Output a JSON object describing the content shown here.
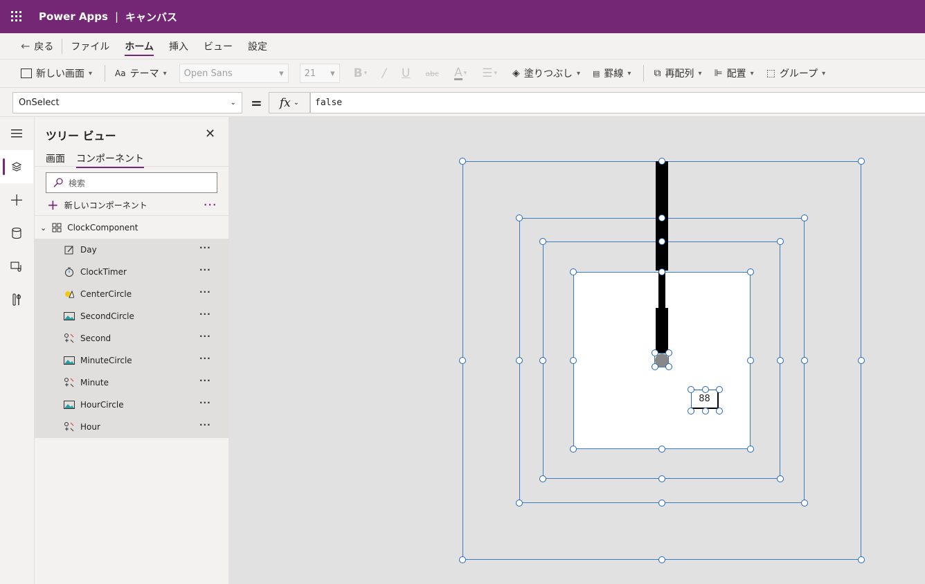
{
  "app": {
    "name": "Power Apps",
    "separator": "|",
    "section": "キャンバス"
  },
  "menu": {
    "back": "戻る",
    "file": "ファイル",
    "home": "ホーム",
    "insert": "挿入",
    "view": "ビュー",
    "settings": "設定"
  },
  "ribbon": {
    "new_screen": "新しい画面",
    "theme": "テーマ",
    "font": "Open Sans",
    "font_size": "21",
    "bold": "B",
    "italic": "/",
    "underline": "U",
    "strikethrough": "abc",
    "font_color": "A",
    "fill": "塗りつぶし",
    "border": "罫線",
    "reorder": "再配列",
    "align": "配置",
    "group": "グループ"
  },
  "formula": {
    "property": "OnSelect",
    "equals": "=",
    "fx": "fx",
    "value": "false"
  },
  "tree": {
    "title": "ツリー ビュー",
    "tabs": [
      "画面",
      "コンポーネント"
    ],
    "search_placeholder": "検索",
    "new_component": "新しいコンポーネント",
    "component_name": "ClockComponent",
    "children": [
      {
        "name": "Day",
        "icon": "edit-icon"
      },
      {
        "name": "ClockTimer",
        "icon": "timer-icon"
      },
      {
        "name": "CenterCircle",
        "icon": "shape-icon"
      },
      {
        "name": "SecondCircle",
        "icon": "image-icon"
      },
      {
        "name": "Second",
        "icon": "icon-control-icon"
      },
      {
        "name": "MinuteCircle",
        "icon": "image-icon"
      },
      {
        "name": "Minute",
        "icon": "icon-control-icon"
      },
      {
        "name": "HourCircle",
        "icon": "image-icon"
      },
      {
        "name": "Hour",
        "icon": "icon-control-icon"
      }
    ]
  },
  "canvas": {
    "day_value": "88"
  },
  "colors": {
    "brand": "#742774",
    "selection": "#3b7bc0"
  }
}
